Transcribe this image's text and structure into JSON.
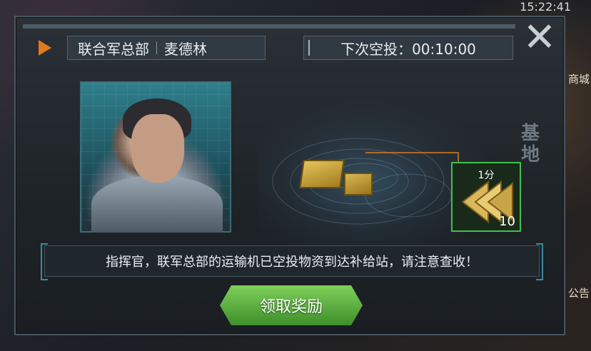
{
  "status_bar": {
    "clock": "15:22:41"
  },
  "background": {
    "right_label_1": "商城",
    "right_label_2": "公告"
  },
  "dialog": {
    "header_label": "联合军总部",
    "officer_name": "麦德林",
    "timer_text": "下次空投：00:10:00",
    "close_icon": "close-x-icon",
    "side_label": "基地",
    "reward": {
      "time_label": "1分",
      "quantity": "10",
      "icon": "chevron-rank-icon",
      "border_color": "#41c04c"
    },
    "message": "指挥官，联军总部的运输机已空投物资到达补给站，请注意查收！",
    "claim_button": "领取奖励"
  },
  "colors": {
    "accent_orange": "#e07a1c",
    "button_green": "#5fb444"
  }
}
